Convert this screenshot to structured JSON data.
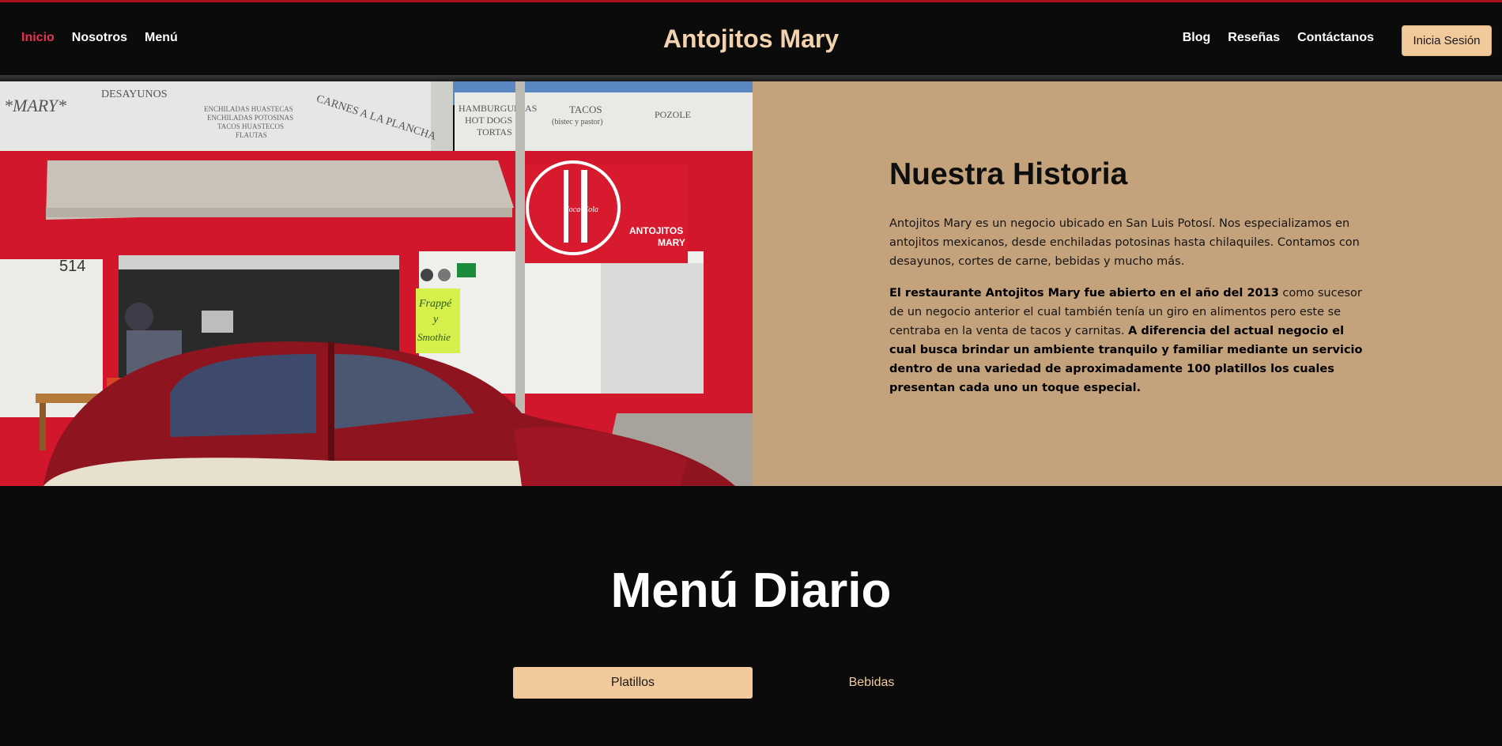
{
  "nav": {
    "left_links": [
      "Inicio",
      "Nosotros",
      "Menú"
    ],
    "brand": "Antojitos Mary",
    "right_links": [
      "Blog",
      "Reseñas",
      "Contáctanos"
    ],
    "login_label": "Inicia Sesión"
  },
  "hero_photo": {
    "sign_texts": [
      "*MARY*",
      "DESAYUNOS",
      "ENCHILADAS HUASTECAS",
      "ENCHILADAS POTOSINAS",
      "TACOS HUASTECOS",
      "FLAUTAS",
      "CARNES A LA PLANCHA",
      "HAMBURGUESAS",
      "HOT DOGS",
      "TORTAS",
      "TACOS",
      "(bistec y pastor)",
      "POZOLE",
      "ANTOJITOS",
      "MARY",
      "514",
      "Frappé",
      "y",
      "Smothie",
      "Coca-Cola"
    ]
  },
  "story": {
    "title": "Nuestra Historia",
    "p1": "Antojitos Mary es un negocio ubicado en San Luis Potosí. Nos especializamos en antojitos mexicanos, desde enchiladas potosinas hasta chilaquiles. Contamos con desayunos, cortes de carne, bebidas y mucho más.",
    "p2_bold_1": "El restaurante Antojitos Mary fue abierto en el año del 2013",
    "p2_normal": " como sucesor de un negocio anterior el cual también tenía un giro en alimentos pero este se centraba en la venta de tacos y carnitas. ",
    "p2_bold_2": "A diferencia del actual negocio el cual busca brindar un ambiente tranquilo y familiar mediante un servicio dentro de una variedad de aproximadamente 100 platillos los cuales presentan cada uno un toque especial."
  },
  "menu": {
    "title": "Menú Diario",
    "tabs": [
      "Platillos",
      "Bebidas"
    ]
  },
  "colors": {
    "accent_red": "#e63352",
    "brand_cream": "#f2d3ae",
    "button_peach": "#f1c99a",
    "story_bg": "#c4a27b",
    "page_bg": "#0b0b0b"
  }
}
